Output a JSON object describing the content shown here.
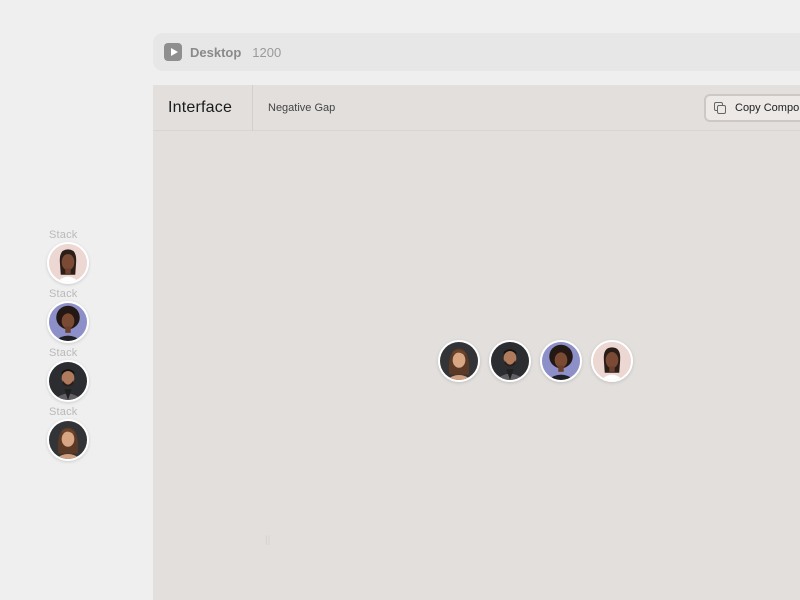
{
  "topbar": {
    "device": "Desktop",
    "width": "1200"
  },
  "preview": {
    "brand": "Interface",
    "crumb": "Negative Gap",
    "copy_label": "Copy Compor"
  },
  "sidebar_stacks": [
    {
      "label": "Stack",
      "avatar": "woman-long-hair-light-bg"
    },
    {
      "label": "Stack",
      "avatar": "woman-curly-hair-blue-bg"
    },
    {
      "label": "Stack",
      "avatar": "man-beard-dark-bg"
    },
    {
      "label": "Stack",
      "avatar": "woman-wavy-hair-dark-bg"
    }
  ],
  "row_avatars": [
    "woman-wavy-hair-dark-bg",
    "man-beard-dark-bg",
    "woman-curly-hair-blue-bg",
    "woman-long-hair-light-bg"
  ],
  "colors": {
    "page_bg": "#efefef",
    "preview_bg": "#e2dfdd",
    "avatar_border": "#ffffff"
  },
  "faint_mark": "||"
}
